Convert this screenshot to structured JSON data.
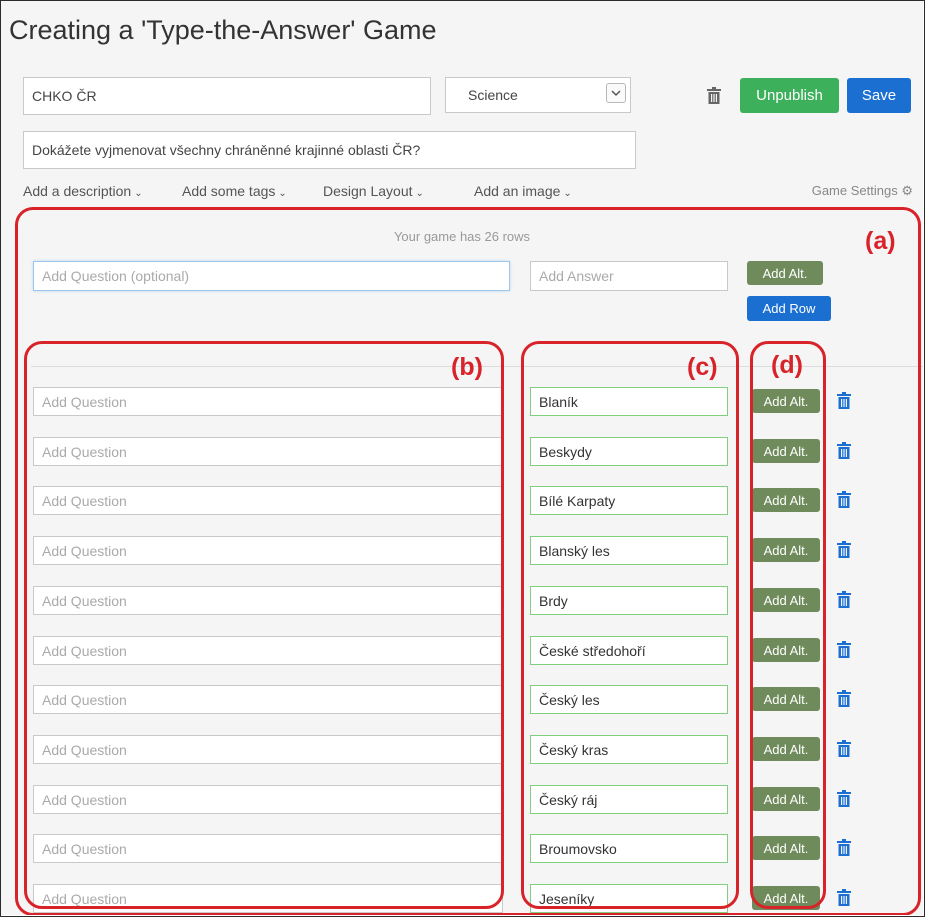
{
  "header": {
    "title": "Creating a 'Type-the-Answer' Game"
  },
  "game": {
    "name": "CHKO ČR",
    "category": "Science",
    "subtitle": "Dokážete vyjmenovat všechny chráněnné krajinné oblasti ČR?"
  },
  "toolbar": {
    "unpublish_label": "Unpublish",
    "save_label": "Save"
  },
  "menu": {
    "description": "Add a description",
    "tags": "Add some tags",
    "layout": "Design Layout",
    "image": "Add an image",
    "settings": "Game Settings"
  },
  "editor": {
    "rows_note": "Your game has 26 rows",
    "question_placeholder": "Add Question (optional)",
    "answer_placeholder": "Add Answer",
    "add_alt_label": "Add Alt.",
    "add_row_label": "Add Row"
  },
  "rows": {
    "question_placeholder": "Add Question",
    "add_alt_label": "Add Alt.",
    "answers": [
      "Blaník",
      "Beskydy",
      "Bílé Karpaty",
      "Blanský les",
      "Brdy",
      "České středohoří",
      "Český les",
      "Český kras",
      "Český ráj",
      "Broumovsko",
      "Jeseníky"
    ]
  },
  "annotations": {
    "a": "(a)",
    "b": "(b)",
    "c": "(c)",
    "d": "(d)"
  },
  "icons": {
    "trash": "trash-icon",
    "chevron": "chevron-down-icon",
    "gear": "gear-icon",
    "select_caret": "chevron-down-icon"
  },
  "colors": {
    "green": "#3cb05a",
    "blue": "#1a6fd1",
    "alt_button": "#6f8a5b",
    "annotation": "#d8232a",
    "answer_border": "#7fcf7f"
  }
}
